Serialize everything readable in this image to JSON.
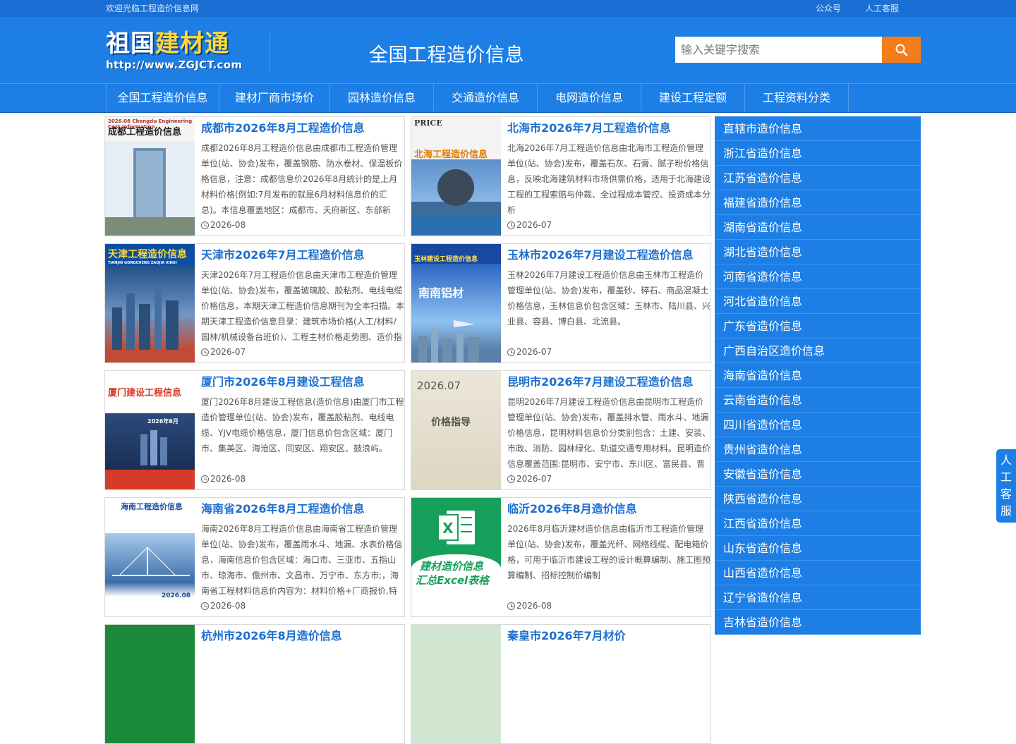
{
  "topbar": {
    "welcome": "欢迎光临工程造价信息网",
    "links": [
      "公众号",
      "人工客服"
    ]
  },
  "header": {
    "logo_main_a": "祖国",
    "logo_main_b": "建材通",
    "logo_url": "http://www.ZGJCT.com",
    "site_title": "全国工程造价信息",
    "search_placeholder": "输入关键字搜索",
    "search_icon": "search-icon"
  },
  "nav": {
    "items": [
      "全国工程造价信息",
      "建材厂商市场价",
      "园林造价信息",
      "交通造价信息",
      "电网造价信息",
      "建设工程定额",
      "工程资料分类"
    ]
  },
  "cards": [
    {
      "title": "成都市2026年8月工程造价信息",
      "desc": "成都2026年8月工程造价信息由成都市工程造价管理单位(站、协会)发布，覆盖钢筋、防水卷材、保温板价格信息，注意：成都信息价2026年8月统计的是上月材料价格(例如:7月发布的就是6月材料信息价的汇总)。本信息覆盖地区：成都市、天府新区、东部新区、龙泉驿",
      "date": "2026-08",
      "cover_text": "成都工程造价信息",
      "cover_top": "2026.08  Chengdu Engineering Cost Information"
    },
    {
      "title": "北海市2026年7月工程造价信息",
      "desc": "北海2026年7月工程造价信息由北海市工程造价管理单位(站、协会)发布，覆盖石灰、石膏、腻子粉价格信息，反映北海建筑材料市场供需价格，适用于北海建设工程的工程索赔与仲裁、全过程成本管控、投资成本分析",
      "date": "2026-07",
      "cover_text": "北海工程造价信息",
      "cover_top": "PRICE"
    },
    {
      "title": "天津市2026年7月工程造价信息",
      "desc": "天津2026年7月工程造价信息由天津市工程造价管理单位(站、协会)发布，覆盖玻璃胶、胶粘剂、电线电缆价格信息，本期天津工程造价信息期刊为全本扫描。本期天津工程造价信息目录：建筑市场价格(人工/材料/园林/机械设备台班价)、工程主材价格走势图、造价指数",
      "date": "2026-07",
      "cover_text": "天津工程造价信息",
      "cover_top": "TIANJIN GONGCHENG ZAOJIA XINXI"
    },
    {
      "title": "玉林市2026年7月建设工程造价信息",
      "desc": "玉林2026年7月建设工程造价信息由玉林市工程造价管理单位(站、协会)发布，覆盖砂、碎石、商品混凝土价格信息，玉林信息价包含区域：玉林市、陆川县、兴业县、容县、博白县、北流县。",
      "date": "2026-07",
      "cover_text": "南南铝材",
      "cover_top": "玉林建设工程造价信息"
    },
    {
      "title": "厦门市2026年8月建设工程信息",
      "desc": "厦门2026年8月建设工程信息(造价信息)由厦门市工程造价管理单位(站、协会)发布，覆盖胶粘剂、电线电缆、YJV电缆价格信息，厦门信息价包含区域：厦门市、集美区、海沧区、同安区、翔安区、鼓浪屿。",
      "date": "2026-08",
      "cover_text": "厦门建设工程信息",
      "cover_top": "2026年8月"
    },
    {
      "title": "昆明市2026年7月建设工程造价信息",
      "desc": "昆明2026年7月建设工程造价信息由昆明市工程造价管理单位(站、协会)发布，覆盖排水管、雨水斗、地漏价格信息，昆明材料信息价分类别包含：土建、安装、市政、消防、园林绿化、轨道交通专用材料。昆明造价信息覆盖范围:昆明市、安宁市、东川区、富民县、晋宁",
      "date": "2026-07",
      "cover_text": "价格指导",
      "cover_top": "2026.07"
    },
    {
      "title": "海南省2026年8月工程造价信息",
      "desc": "海南2026年8月工程造价信息由海南省工程造价管理单位(站、协会)发布，覆盖雨水斗、地漏、水表价格信息，海南信息价包含区域：海口市、三亚市、五指山市、琼海市、儋州市、文昌市、万宁市、东方市;，海南省工程材料信息价内容为：材料价格+厂商报价,特别",
      "date": "2026-08",
      "cover_text": "海南工程造价信息",
      "cover_top": "2026.08"
    },
    {
      "title": "临沂2026年8月造价信息",
      "desc": "2026年8月临沂建材造价信息由临沂市工程造价管理单位(站、协会)发布，覆盖光纤、网络线缆、配电箱价格，可用于临沂市建设工程的设计概算编制、施工图预算编制、招标控制价编制",
      "date": "2026-08",
      "cover_text": "建材造价信息",
      "cover_top": "汇总Excel表格"
    },
    {
      "title": "杭州市2026年8月造价信息",
      "desc": "",
      "date": "",
      "cover_text": "",
      "cover_top": ""
    },
    {
      "title": "秦皇市2026年7月材价",
      "desc": "",
      "date": "",
      "cover_text": "",
      "cover_top": ""
    }
  ],
  "sidebar": {
    "items": [
      "直辖市造价信息",
      "浙江省造价信息",
      "江苏省造价信息",
      "福建省造价信息",
      "湖南省造价信息",
      "湖北省造价信息",
      "河南省造价信息",
      "河北省造价信息",
      "广东省造价信息",
      "广西自治区造价信息",
      "海南省造价信息",
      "云南省造价信息",
      "四川省造价信息",
      "贵州省造价信息",
      "安徽省造价信息",
      "陕西省造价信息",
      "江西省造价信息",
      "山东省造价信息",
      "山西省造价信息",
      "辽宁省造价信息",
      "吉林省造价信息"
    ]
  },
  "float_service": {
    "chars": [
      "人",
      "工",
      "客",
      "服"
    ]
  },
  "colors": {
    "primary_blue": "#1d7fe6",
    "topbar_blue": "#1a6fd4",
    "search_orange": "#f47c1b",
    "title_blue": "#1d6fcf"
  }
}
